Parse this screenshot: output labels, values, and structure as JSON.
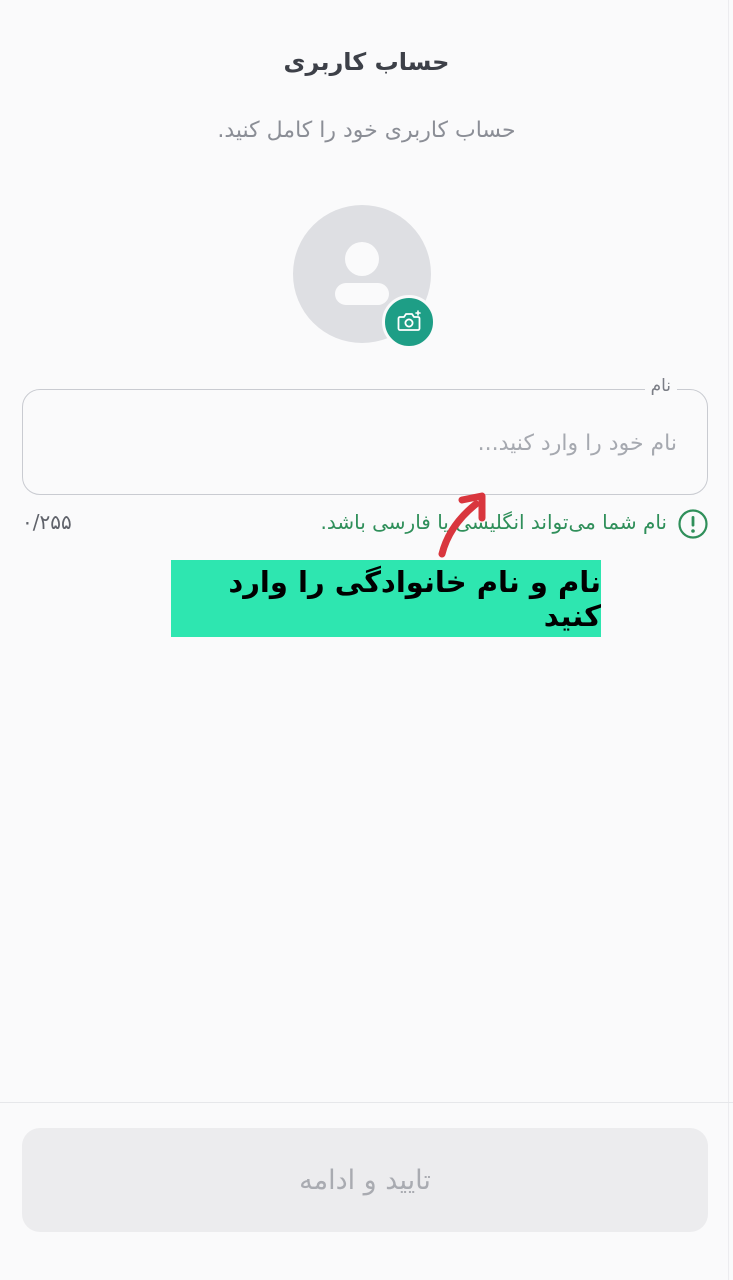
{
  "header": {
    "title": "حساب کاربری",
    "subtitle": "حساب کاربری خود را کامل کنید."
  },
  "avatar": {
    "icon": "user-icon",
    "camera_icon": "camera-icon"
  },
  "name_field": {
    "label": "نام",
    "value": "",
    "placeholder": "نام خود را وارد کنید..."
  },
  "helper": {
    "icon": "info-icon",
    "text": "نام شما می‌تواند انگلیسی یا فارسی باشد.",
    "counter": "۰/۲۵۵"
  },
  "annotation": {
    "text": "نام و نام خانوادگی را وارد کنید",
    "banner_color": "#2ee6b0",
    "arrow_color": "#d9363e"
  },
  "footer": {
    "confirm_label": "تایید و ادامه"
  },
  "colors": {
    "accent": "#1e9e86",
    "helper_green": "#2f8f5a"
  }
}
